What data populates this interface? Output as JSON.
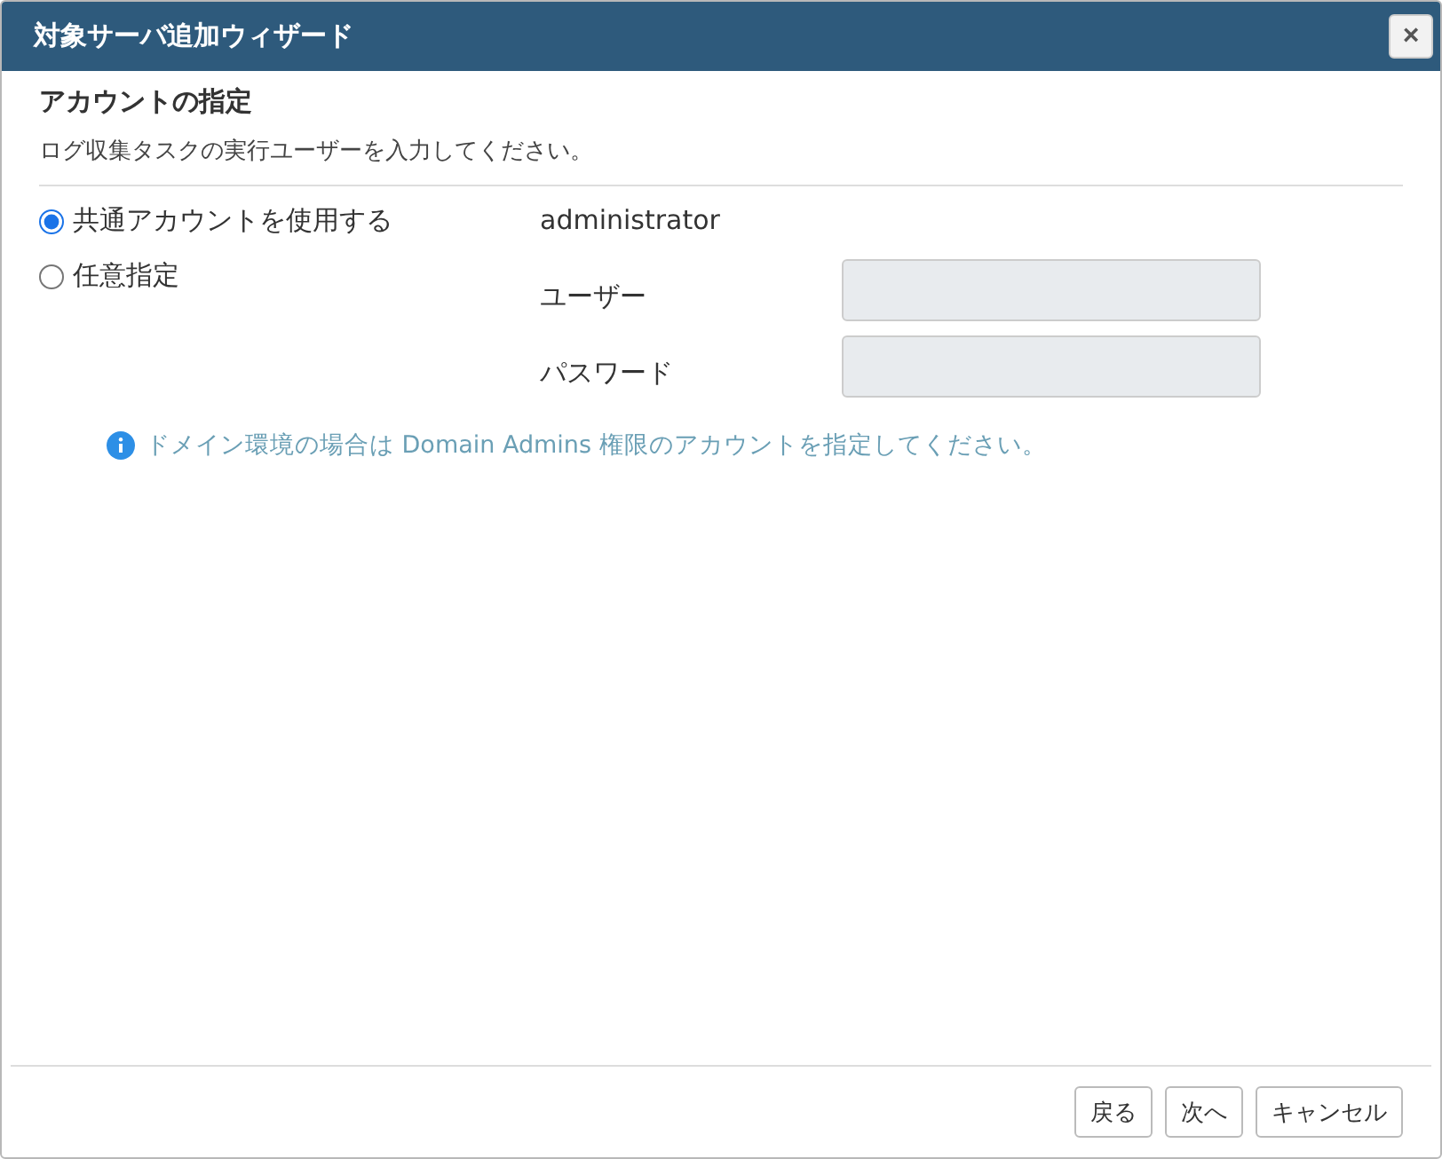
{
  "window": {
    "title": "対象サーバ追加ウィザード",
    "close": "×"
  },
  "section": {
    "heading": "アカウントの指定",
    "description": "ログ収集タスクの実行ユーザーを入力してください。"
  },
  "options": [
    {
      "label": "共通アカウントを使用する",
      "selected": true,
      "value": "administrator"
    },
    {
      "label": "任意指定",
      "selected": false,
      "fields": [
        {
          "label": "ユーザー",
          "disabled": true
        },
        {
          "label": "パスワード",
          "disabled": true
        }
      ]
    }
  ],
  "note": "ドメイン環境の場合は Domain Admins 権限のアカウントを指定してください。",
  "buttons": [
    "戻る",
    "次へ",
    "キャンセル"
  ]
}
